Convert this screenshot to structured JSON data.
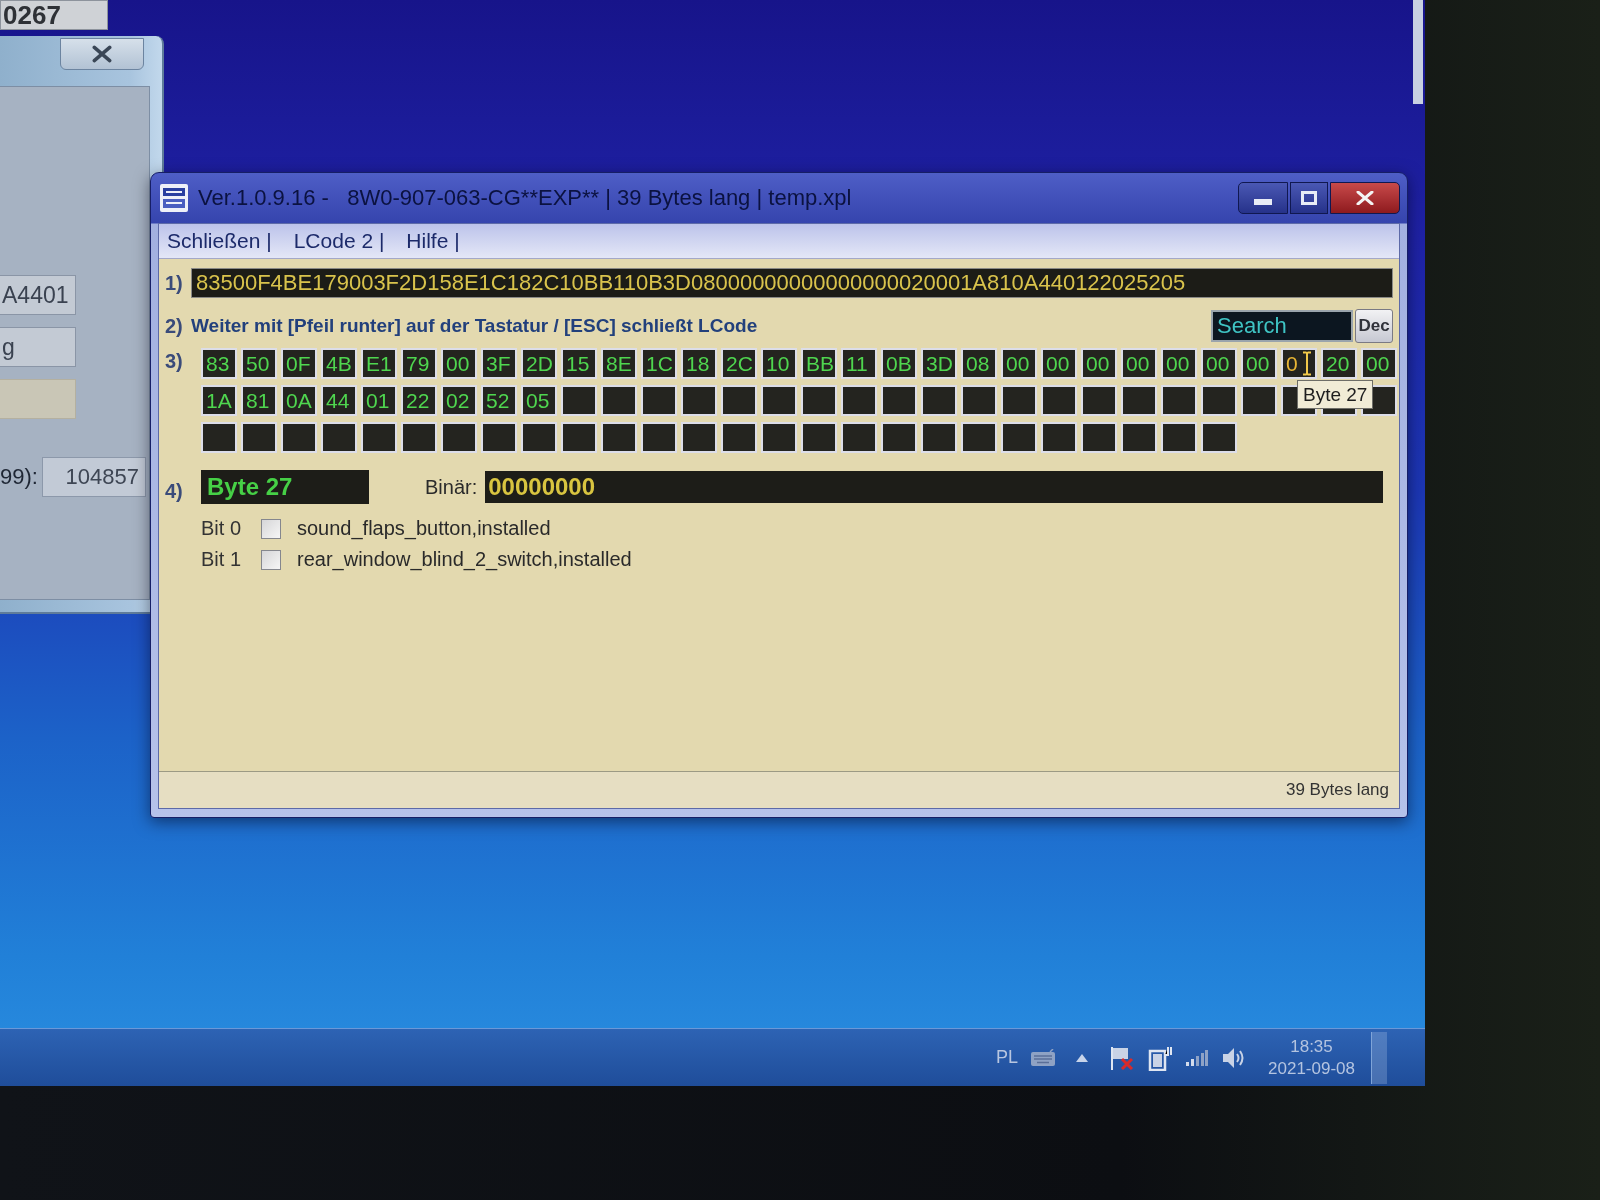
{
  "top_window": {
    "field": "0267"
  },
  "left_window": {
    "fields": [
      {
        "kind": "text",
        "value": "A4401"
      },
      {
        "kind": "text",
        "value": "g"
      },
      {
        "kind": "blank"
      }
    ],
    "labeled_field": {
      "label": "99):",
      "value": "104857"
    }
  },
  "window": {
    "title": "Ver.1.0.9.16 -   8W0-907-063-CG**EXP** | 39 Bytes lang | temp.xpl",
    "menu": [
      "Schließen |",
      "LCode 2 |",
      "Hilfe |"
    ],
    "lcode": {
      "marker": "1)",
      "value": "83500F4BE179003F2D158E1C182C10BB110B3D08000000000000000020001A810A440122025205"
    },
    "hint": {
      "marker": "2)",
      "text": "Weiter mit [Pfeil runter] auf der Tastatur / [ESC] schließt LCode"
    },
    "search": {
      "placeholder": "Search"
    },
    "dec_button": "Dec",
    "byte_grid": {
      "marker": "3)",
      "rows": [
        [
          {
            "kind": "byte",
            "text": "83",
            "selected": false
          },
          {
            "kind": "byte",
            "text": "50",
            "selected": false
          },
          {
            "kind": "byte",
            "text": "0F",
            "selected": false
          },
          {
            "kind": "byte",
            "text": "4B",
            "selected": false
          },
          {
            "kind": "byte",
            "text": "E1",
            "selected": false
          },
          {
            "kind": "byte",
            "text": "79",
            "selected": false
          },
          {
            "kind": "byte",
            "text": "00",
            "selected": false
          },
          {
            "kind": "byte",
            "text": "3F",
            "selected": false
          },
          {
            "kind": "byte",
            "text": "2D",
            "selected": false
          },
          {
            "kind": "byte",
            "text": "15",
            "selected": false
          },
          {
            "kind": "byte",
            "text": "8E",
            "selected": false
          },
          {
            "kind": "byte",
            "text": "1C",
            "selected": false
          },
          {
            "kind": "byte",
            "text": "18",
            "selected": false
          },
          {
            "kind": "byte",
            "text": "2C",
            "selected": false
          },
          {
            "kind": "byte",
            "text": "10",
            "selected": false
          },
          {
            "kind": "byte",
            "text": "BB",
            "selected": false
          },
          {
            "kind": "byte",
            "text": "11",
            "selected": false
          },
          {
            "kind": "byte",
            "text": "0B",
            "selected": false
          },
          {
            "kind": "byte",
            "text": "3D",
            "selected": false
          },
          {
            "kind": "byte",
            "text": "08",
            "selected": false
          },
          {
            "kind": "byte",
            "text": "00",
            "selected": false
          },
          {
            "kind": "byte",
            "text": "00",
            "selected": false
          },
          {
            "kind": "byte",
            "text": "00",
            "selected": false
          },
          {
            "kind": "byte",
            "text": "00",
            "selected": false
          },
          {
            "kind": "byte",
            "text": "00",
            "selected": false
          },
          {
            "kind": "byte",
            "text": "00",
            "selected": false
          },
          {
            "kind": "byte",
            "text": "00",
            "selected": false
          },
          {
            "kind": "byte",
            "text": "0",
            "selected": true
          },
          {
            "kind": "byte",
            "text": "20",
            "selected": false
          },
          {
            "kind": "byte",
            "text": "00",
            "selected": false
          }
        ],
        [
          {
            "kind": "byte",
            "text": "1A",
            "selected": false
          },
          {
            "kind": "byte",
            "text": "81",
            "selected": false
          },
          {
            "kind": "byte",
            "text": "0A",
            "selected": false
          },
          {
            "kind": "byte",
            "text": "44",
            "selected": false
          },
          {
            "kind": "byte",
            "text": "01",
            "selected": false
          },
          {
            "kind": "byte",
            "text": "22",
            "selected": false
          },
          {
            "kind": "byte",
            "text": "02",
            "selected": false
          },
          {
            "kind": "byte",
            "text": "52",
            "selected": false
          },
          {
            "kind": "byte",
            "text": "05",
            "selected": false
          },
          {
            "kind": "empty",
            "selected": false
          },
          {
            "kind": "empty",
            "selected": false
          },
          {
            "kind": "empty",
            "selected": false
          },
          {
            "kind": "empty",
            "selected": false
          },
          {
            "kind": "empty",
            "selected": false
          },
          {
            "kind": "empty",
            "selected": false
          },
          {
            "kind": "empty",
            "selected": false
          },
          {
            "kind": "empty",
            "selected": false
          },
          {
            "kind": "empty",
            "selected": false
          },
          {
            "kind": "empty",
            "selected": false
          },
          {
            "kind": "empty",
            "selected": false
          },
          {
            "kind": "empty",
            "selected": false
          },
          {
            "kind": "empty",
            "selected": false
          },
          {
            "kind": "empty",
            "selected": false
          },
          {
            "kind": "empty",
            "selected": false
          },
          {
            "kind": "empty",
            "selected": false
          },
          {
            "kind": "empty",
            "selected": false
          },
          {
            "kind": "empty",
            "selected": false
          },
          {
            "kind": "empty",
            "selected": false
          },
          {
            "kind": "empty",
            "selected": false
          },
          {
            "kind": "empty",
            "selected": false
          }
        ],
        [
          {
            "kind": "empty",
            "selected": false
          },
          {
            "kind": "empty",
            "selected": false
          },
          {
            "kind": "empty",
            "selected": false
          },
          {
            "kind": "empty",
            "selected": false
          },
          {
            "kind": "empty",
            "selected": false
          },
          {
            "kind": "empty",
            "selected": false
          },
          {
            "kind": "empty",
            "selected": false
          },
          {
            "kind": "empty",
            "selected": false
          },
          {
            "kind": "empty",
            "selected": false
          },
          {
            "kind": "empty",
            "selected": false
          },
          {
            "kind": "empty",
            "selected": false
          },
          {
            "kind": "empty",
            "selected": false
          },
          {
            "kind": "empty",
            "selected": false
          },
          {
            "kind": "empty",
            "selected": false
          },
          {
            "kind": "empty",
            "selected": false
          },
          {
            "kind": "empty",
            "selected": false
          },
          {
            "kind": "empty",
            "selected": false
          },
          {
            "kind": "empty",
            "selected": false
          },
          {
            "kind": "empty",
            "selected": false
          },
          {
            "kind": "empty",
            "selected": false
          },
          {
            "kind": "empty",
            "selected": false
          },
          {
            "kind": "empty",
            "selected": false
          },
          {
            "kind": "empty",
            "selected": false
          },
          {
            "kind": "empty",
            "selected": false
          },
          {
            "kind": "empty",
            "selected": false
          },
          {
            "kind": "empty",
            "selected": false
          }
        ]
      ]
    },
    "tooltip": "Byte 27",
    "byte_detail": {
      "marker": "4)",
      "byte_field": "Byte 27",
      "binary_label": "Binär:",
      "binary_value": "00000000"
    },
    "bits": [
      {
        "label": "Bit 0",
        "checked": false,
        "description": "sound_flaps_button,installed"
      },
      {
        "label": "Bit 1",
        "checked": false,
        "description": "rear_window_blind_2_switch,installed"
      }
    ],
    "status_bar": {
      "text": "39 Bytes lang"
    }
  },
  "taskbar": {
    "language": "PL",
    "time": "18:35",
    "date": "2021-09-08"
  }
}
